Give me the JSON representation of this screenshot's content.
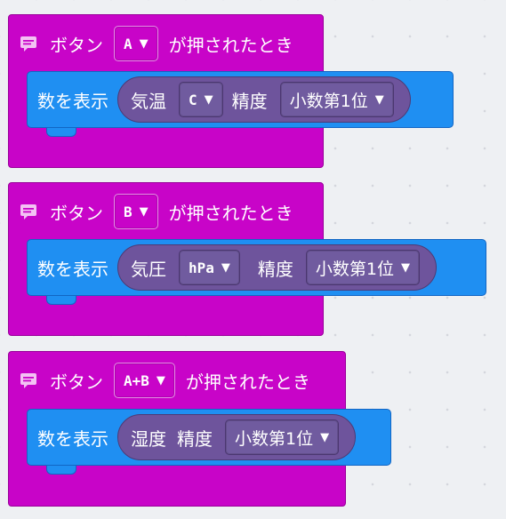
{
  "blocks": [
    {
      "event": {
        "label": "ボタン",
        "button": "A",
        "suffix": "が押されたとき"
      },
      "statement": {
        "label": "数を表示",
        "reporter": [
          {
            "kind": "text",
            "value": "気温"
          },
          {
            "kind": "dropdown",
            "value": "C"
          },
          {
            "kind": "text",
            "value": "精度"
          },
          {
            "kind": "dropdown-jp",
            "value": "小数第1位"
          }
        ]
      }
    },
    {
      "event": {
        "label": "ボタン",
        "button": "B",
        "suffix": "が押されたとき"
      },
      "statement": {
        "label": "数を表示",
        "reporter": [
          {
            "kind": "text",
            "value": "気圧"
          },
          {
            "kind": "dropdown",
            "value": "hPa"
          },
          {
            "kind": "text",
            "value": "精度"
          },
          {
            "kind": "dropdown-jp",
            "value": "小数第1位"
          }
        ]
      }
    },
    {
      "event": {
        "label": "ボタン",
        "button": "A+B",
        "suffix": "が押されたとき"
      },
      "statement": {
        "label": "数を表示",
        "reporter": [
          {
            "kind": "text",
            "value": "湿度"
          },
          {
            "kind": "text",
            "value": "精度"
          },
          {
            "kind": "dropdown-jp",
            "value": "小数第1位"
          }
        ]
      }
    }
  ],
  "icons": {
    "comment": "comment-icon",
    "caret": "caret-down-icon"
  },
  "colors": {
    "event": "#c804c8",
    "statement": "#1f8ff2",
    "reporter": "#6e549c",
    "workspace": "#eef0f3"
  }
}
